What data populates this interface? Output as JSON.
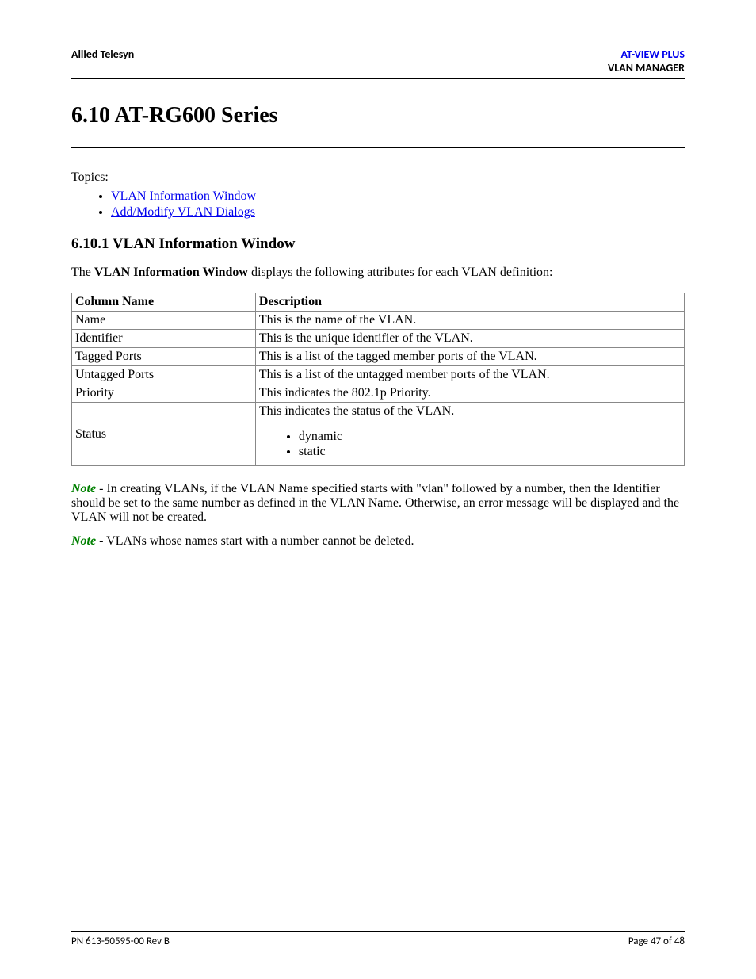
{
  "header": {
    "left": "Allied Telesyn",
    "right_brand": "AT-VIEW PLUS",
    "right_sub": "VLAN MANAGER"
  },
  "section": {
    "title": "6.10 AT-RG600 Series",
    "topics_label": "Topics:",
    "topics": [
      "VLAN Information Window",
      "Add/Modify VLAN Dialogs"
    ]
  },
  "subsection": {
    "title": "6.10.1 VLAN Information Window",
    "intro_pre": "The ",
    "intro_bold": "VLAN Information Window",
    "intro_post": " displays the following attributes for each VLAN definition:"
  },
  "table": {
    "headers": {
      "col": "Column Name",
      "desc": "Description"
    },
    "rows": [
      {
        "col": "Name",
        "desc": "This is the name of the VLAN."
      },
      {
        "col": "Identifier",
        "desc": "This is the unique identifier of the VLAN."
      },
      {
        "col": "Tagged Ports",
        "desc": "This is a list of the tagged member ports of the VLAN."
      },
      {
        "col": "Untagged Ports",
        "desc": "This is a list of the untagged member ports of the VLAN."
      },
      {
        "col": "Priority",
        "desc": "This indicates the 802.1p Priority."
      }
    ],
    "status_row": {
      "col": "Status",
      "desc_intro": "This indicates the status of the VLAN.",
      "items": [
        "dynamic",
        "static"
      ]
    }
  },
  "notes": {
    "label": "Note",
    "n1": " - In creating VLANs, if the VLAN Name specified starts with \"vlan\" followed by a number, then the Identifier should be set to the same number as defined in the VLAN Name. Otherwise, an error message will be displayed and the VLAN will not be created.",
    "n2": " - VLANs whose names start with a number cannot be deleted."
  },
  "footer": {
    "left": "PN 613-50595-00 Rev B",
    "right": "Page 47 of 48"
  }
}
